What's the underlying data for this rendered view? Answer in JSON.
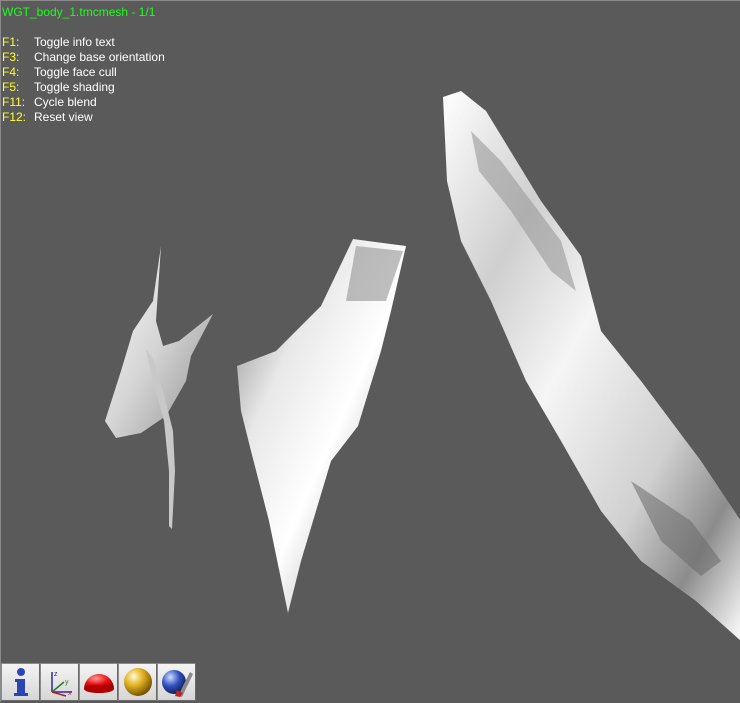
{
  "window": {
    "title": "WGT_body_1.tmcmesh - 1/1"
  },
  "help": [
    {
      "key": "F1:",
      "action": "Toggle info text"
    },
    {
      "key": "F3:",
      "action": "Change base orientation"
    },
    {
      "key": "F4:",
      "action": "Toggle face cull"
    },
    {
      "key": "F5:",
      "action": "Toggle shading"
    },
    {
      "key": "F11:",
      "action": "Cycle blend"
    },
    {
      "key": "F12:",
      "action": "Reset view"
    }
  ],
  "toolbar": {
    "buttons": [
      {
        "icon": "info-icon"
      },
      {
        "icon": "axes-icon"
      },
      {
        "icon": "red-hemisphere-icon"
      },
      {
        "icon": "gold-sphere-icon"
      },
      {
        "icon": "blue-sphere-brush-icon"
      }
    ]
  },
  "colors": {
    "background": "#5a5a5a",
    "title": "#1aff1a",
    "help_key": "#ffff33",
    "help_text": "#ffffff"
  }
}
